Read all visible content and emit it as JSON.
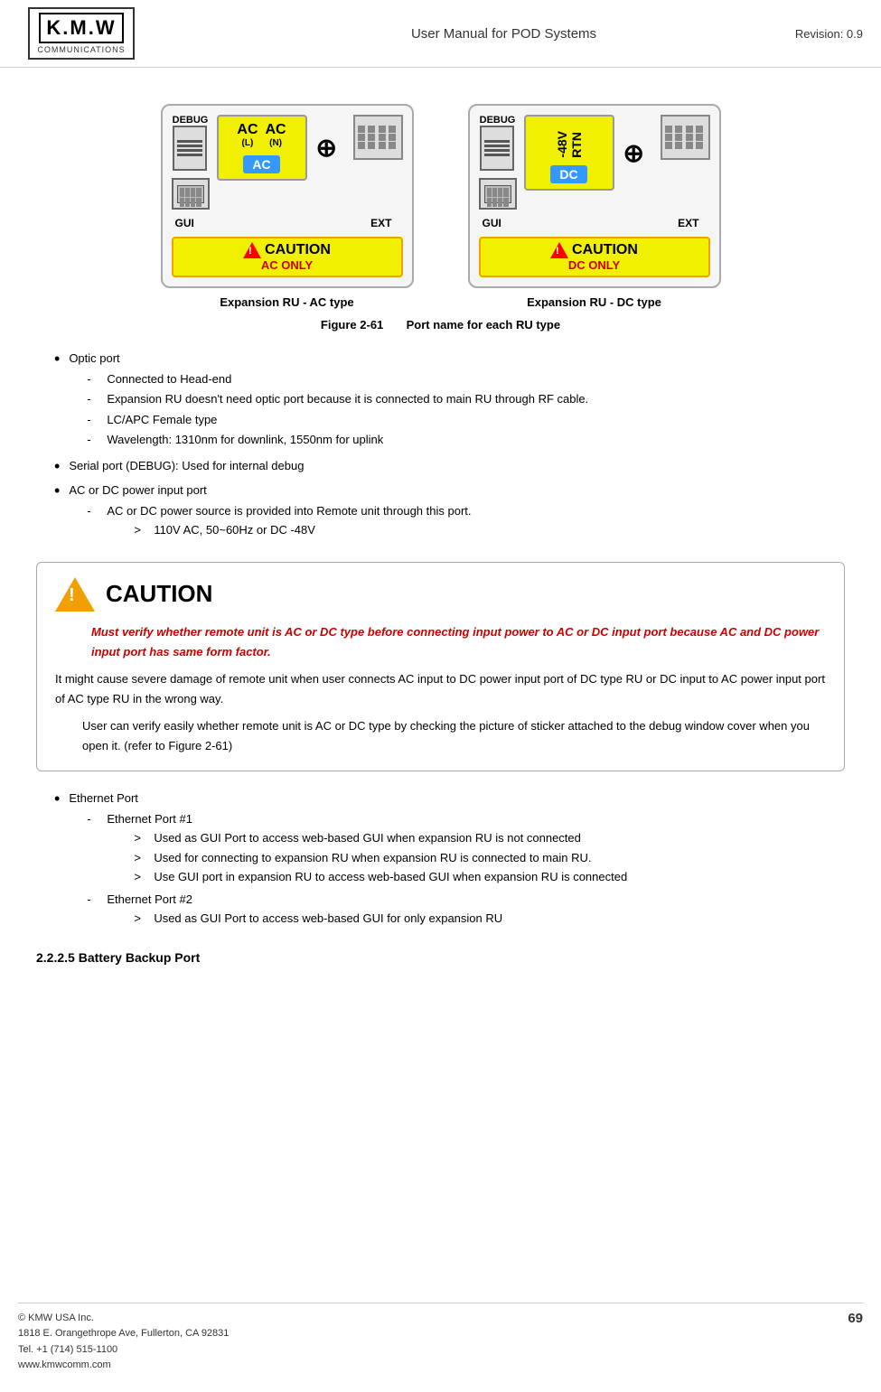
{
  "header": {
    "logo_text": "K.M.W",
    "logo_sub": "COMMUNICATIONS",
    "title": "User Manual for POD Systems",
    "revision": "Revision: 0.9"
  },
  "figures": {
    "ac_type": {
      "title": "Expansion RU - AC type",
      "debug_label": "DEBUG",
      "gui_label": "GUI",
      "ext_label": "EXT",
      "power_labels": [
        "AC",
        "(L)",
        "AC",
        "(N)"
      ],
      "power_badge": "AC",
      "caution_text": "CAUTION",
      "caution_sub": "AC ONLY"
    },
    "dc_type": {
      "title": "Expansion RU - DC type",
      "debug_label": "DEBUG",
      "gui_label": "GUI",
      "ext_label": "EXT",
      "power_labels": [
        "-48V",
        "RTN"
      ],
      "power_badge": "DC",
      "caution_text": "CAUTION",
      "caution_sub": "DC ONLY"
    },
    "caption_num": "Figure 2-61",
    "caption_text": "Port name for each RU type"
  },
  "bullet_list": [
    {
      "text": "Optic port",
      "sub_items": [
        {
          "text": "Connected to Head-end"
        },
        {
          "text": "Expansion RU doesn't need optic port because it is connected to main RU through RF cable."
        },
        {
          "text": "LC/APC Female type"
        },
        {
          "text": "Wavelength: 1310nm for downlink, 1550nm for uplink"
        }
      ]
    },
    {
      "text": "Serial port (DEBUG): Used for internal debug",
      "sub_items": []
    },
    {
      "text": "AC or DC power input port",
      "sub_items": [
        {
          "text": "AC or DC power source is provided into Remote unit through this port.",
          "sub_sub": [
            {
              "text": "110V AC, 50~60Hz or DC -48V"
            }
          ]
        }
      ]
    }
  ],
  "caution_box": {
    "title": "CAUTION",
    "italic_text": "Must verify whether remote unit is AC or DC type before connecting input power to AC or DC input port because AC and DC power input port has same form factor.",
    "body1": "It might cause severe damage of remote unit when user connects AC input to DC power input port of DC type RU or DC input to AC power input port of AC type RU in the wrong way.",
    "body2": "User can verify easily whether remote unit is AC or DC type by checking the picture of sticker attached to the debug window cover when you open it. (refer to Figure 2-61)"
  },
  "bullet_list2": [
    {
      "text": "Ethernet Port",
      "sub_items": [
        {
          "text": "Ethernet Port #1",
          "sub_sub": [
            {
              "text": "Used as GUI Port to access web-based GUI when expansion RU is not connected"
            },
            {
              "text": "Used for connecting to expansion RU when expansion RU is connected to main RU."
            },
            {
              "text": "Use GUI port in expansion RU to access web-based GUI when expansion RU is connected"
            }
          ]
        },
        {
          "text": "Ethernet Port #2",
          "sub_sub": [
            {
              "text": "Used as GUI Port to access web-based GUI for only expansion RU"
            }
          ]
        }
      ]
    }
  ],
  "section_heading": "2.2.2.5   Battery Backup Port",
  "footer": {
    "company": "© KMW USA Inc.",
    "address": "1818 E. Orangethrope Ave, Fullerton, CA 92831",
    "tel": "Tel. +1 (714) 515-1100",
    "website": "www.kmwcomm.com",
    "page": "69"
  }
}
